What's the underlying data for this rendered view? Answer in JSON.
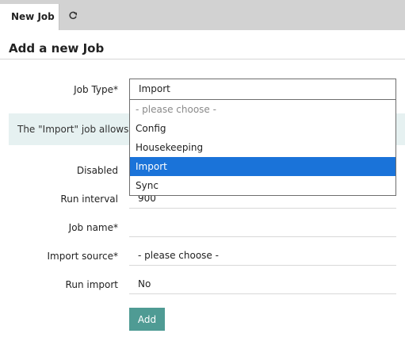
{
  "tabs": {
    "active_label": "New Job",
    "refresh_icon": "refresh-icon"
  },
  "form": {
    "title": "Add a new Job",
    "job_type": {
      "label": "Job Type*",
      "value": "Import"
    },
    "info_text": "The \"Import\" job allows to",
    "disabled": {
      "label": "Disabled"
    },
    "run_interval": {
      "label": "Run interval",
      "value": "900"
    },
    "job_name": {
      "label": "Job name*",
      "value": ""
    },
    "import_source": {
      "label": "Import source*",
      "value": "- please choose -"
    },
    "run_import": {
      "label": "Run import",
      "value": "No"
    },
    "add_label": "Add"
  },
  "dropdown": {
    "options": [
      "- please choose -",
      "Config",
      "Housekeeping",
      "Import",
      "Sync"
    ],
    "selected": "Import"
  },
  "colors": {
    "tabbar": "#d2d2d2",
    "info_bg": "#e6f1f1",
    "selected_option": "#1a73d9",
    "button": "#4f9b94"
  }
}
